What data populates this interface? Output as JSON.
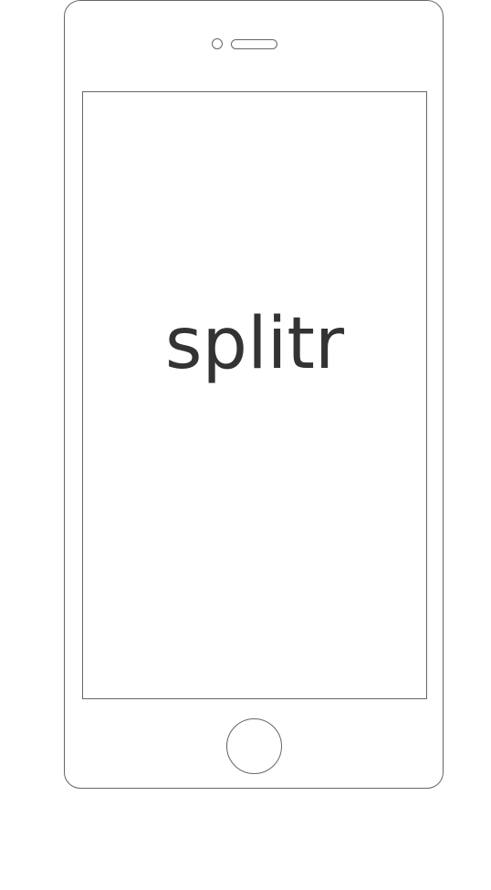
{
  "app": {
    "name": "splitr"
  },
  "device": {
    "type": "phone",
    "icons": {
      "camera": "camera-icon",
      "speaker": "speaker-icon",
      "home_button": "home-button-icon"
    }
  },
  "colors": {
    "outline": "#666666",
    "logo_text": "#333333",
    "background": "#ffffff"
  }
}
